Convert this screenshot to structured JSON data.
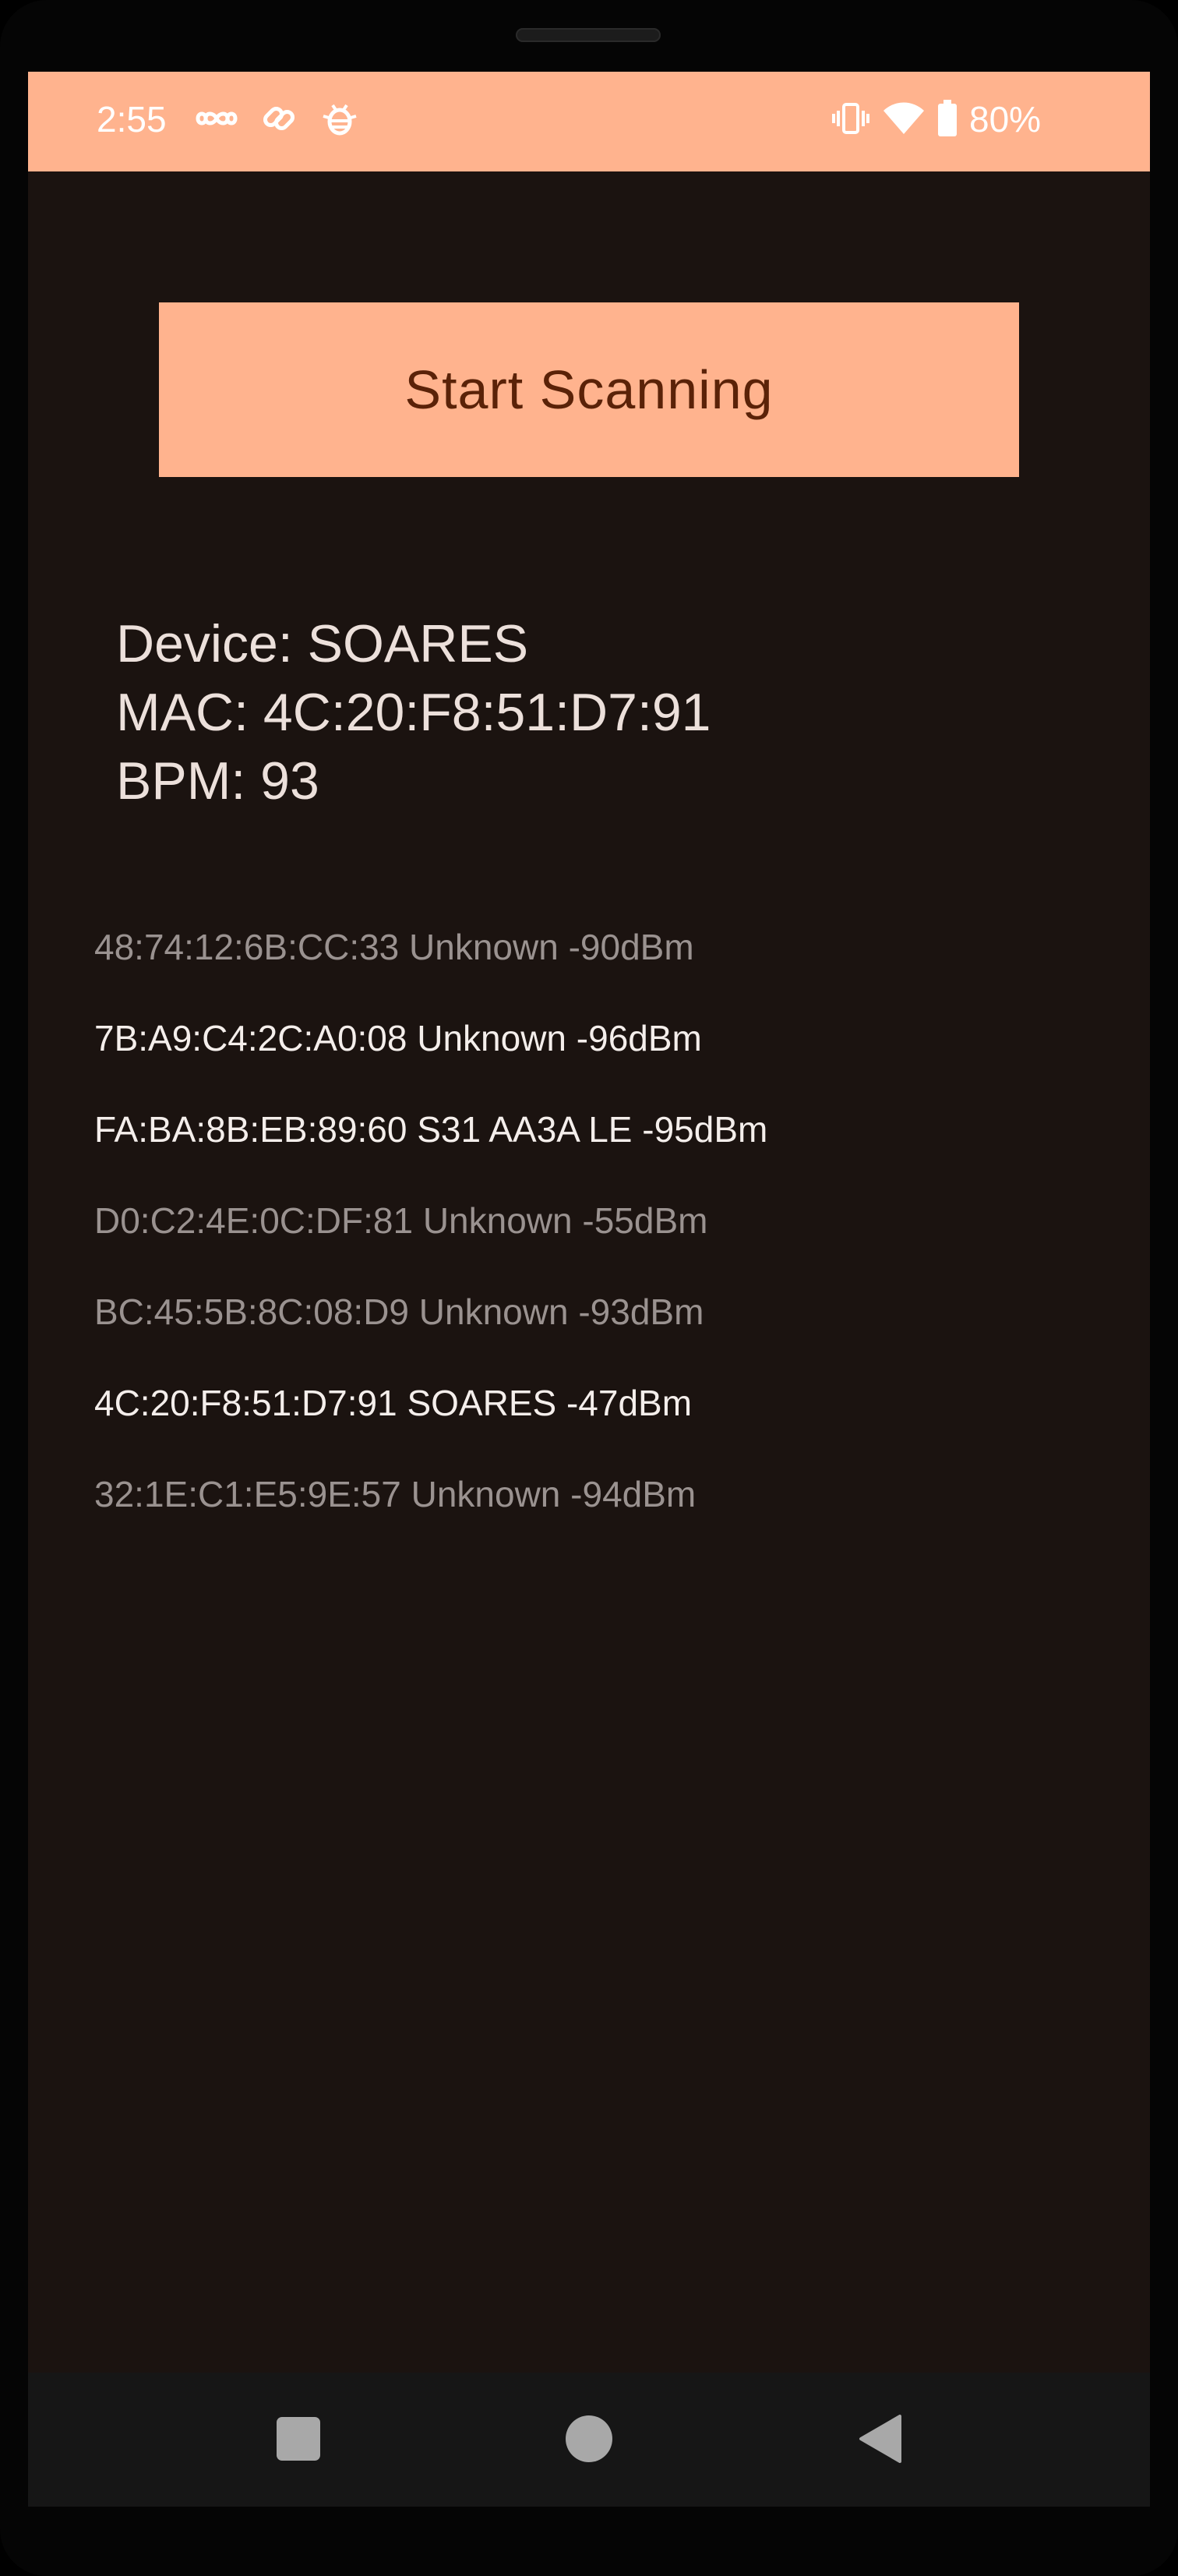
{
  "status_bar": {
    "time": "2:55",
    "battery": "80%",
    "icons": [
      "infinity-icon",
      "link-icon",
      "bug-icon",
      "vibrate-icon",
      "wifi-icon",
      "battery-icon"
    ],
    "background": "#ffb38e"
  },
  "main": {
    "scan_button_label": "Start Scanning",
    "device": {
      "name_line": "Device: SOARES",
      "mac_line": "MAC: 4C:20:F8:51:D7:91",
      "bpm_line": "BPM: 93"
    },
    "scan_results": [
      {
        "text": "48:74:12:6B:CC:33 Unknown -90dBm",
        "color": "#9a9290"
      },
      {
        "text": "7B:A9:C4:2C:A0:08 Unknown -96dBm",
        "color": "#f4eeeb"
      },
      {
        "text": "FA:BA:8B:EB:89:60 S31 AA3A LE -95dBm",
        "color": "#f4eeeb"
      },
      {
        "text": "D0:C2:4E:0C:DF:81 Unknown -55dBm",
        "color": "#9a9290"
      },
      {
        "text": "BC:45:5B:8C:08:D9 Unknown -93dBm",
        "color": "#9a9290"
      },
      {
        "text": "4C:20:F8:51:D7:91 SOARES -47dBm",
        "color": "#f4eeeb"
      },
      {
        "text": "32:1E:C1:E5:9E:57 Unknown -94dBm",
        "color": "#9a9290"
      }
    ]
  },
  "nav_bar": {
    "buttons": [
      "recents-icon",
      "home-icon",
      "back-icon"
    ]
  },
  "colors": {
    "accent": "#ffb38e",
    "button_text": "#5a2208",
    "background": "#1b1310",
    "nav_background": "#161616"
  }
}
